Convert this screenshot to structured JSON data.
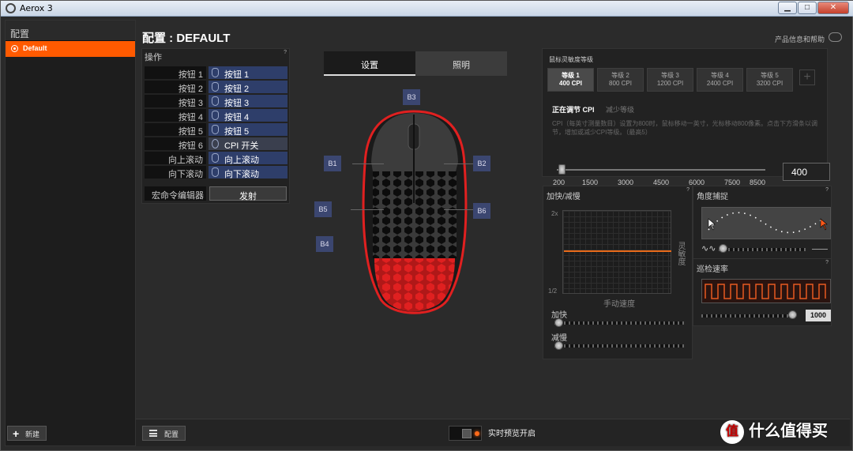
{
  "window": {
    "title": "Aerox 3"
  },
  "sidebar": {
    "header": "配置",
    "item": "Default",
    "new_label": "新建"
  },
  "page": {
    "title": "配置 : DEFAULT",
    "help": "产品信息和帮助"
  },
  "ops": {
    "header": "操作",
    "rows": [
      {
        "label": "按钮 1",
        "value": "按钮 1"
      },
      {
        "label": "按钮 2",
        "value": "按钮 2"
      },
      {
        "label": "按钮 3",
        "value": "按钮 3"
      },
      {
        "label": "按钮 4",
        "value": "按钮 4"
      },
      {
        "label": "按钮 5",
        "value": "按钮 5"
      },
      {
        "label": "按钮 6",
        "value": "CPI 开关"
      },
      {
        "label": "向上滚动",
        "value": "向上滚动"
      },
      {
        "label": "向下滚动",
        "value": "向下滚动"
      }
    ],
    "macro_label": "宏命令编辑器",
    "fire_label": "发射"
  },
  "tabs": {
    "settings": "设置",
    "lighting": "照明"
  },
  "mouse_buttons": {
    "b1": "B1",
    "b2": "B2",
    "b3": "B3",
    "b4": "B4",
    "b5": "B5",
    "b6": "B6"
  },
  "sensitivity": {
    "header": "鼠标灵敏度等级",
    "levels": [
      {
        "name": "等级 1",
        "cpi": "400 CPI"
      },
      {
        "name": "等级 2",
        "cpi": "800 CPI"
      },
      {
        "name": "等级 3",
        "cpi": "1200 CPI"
      },
      {
        "name": "等级 4",
        "cpi": "2400 CPI"
      },
      {
        "name": "等级 5",
        "cpi": "3200 CPI"
      }
    ],
    "add": "+",
    "tab_active": "正在调节 CPI",
    "tab_other": "减少等级",
    "description": "CPI（每英寸测量数目）设置为800时，鼠标移动一英寸，光标移动800像素。点击下方滑条以调节，增加或减少CPI等级。（最高5）",
    "ticks": [
      "200",
      "1500",
      "3000",
      "4500",
      "6000",
      "7500",
      "8500"
    ],
    "value": "400"
  },
  "accel": {
    "header": "加快/减慢",
    "y_top": "2x",
    "y_bottom": "1/2",
    "x_label": "手动速度",
    "side_label": "灵敏度",
    "accel_label": "加快",
    "decel_label": "减慢"
  },
  "angle": {
    "header": "角度捕捉"
  },
  "poll": {
    "header": "巡检速率",
    "value": "1000"
  },
  "bottom": {
    "config_label": "配置",
    "preview_label": "实时预览开启"
  },
  "watermark": {
    "text": "什么值得买",
    "logo": "值"
  }
}
